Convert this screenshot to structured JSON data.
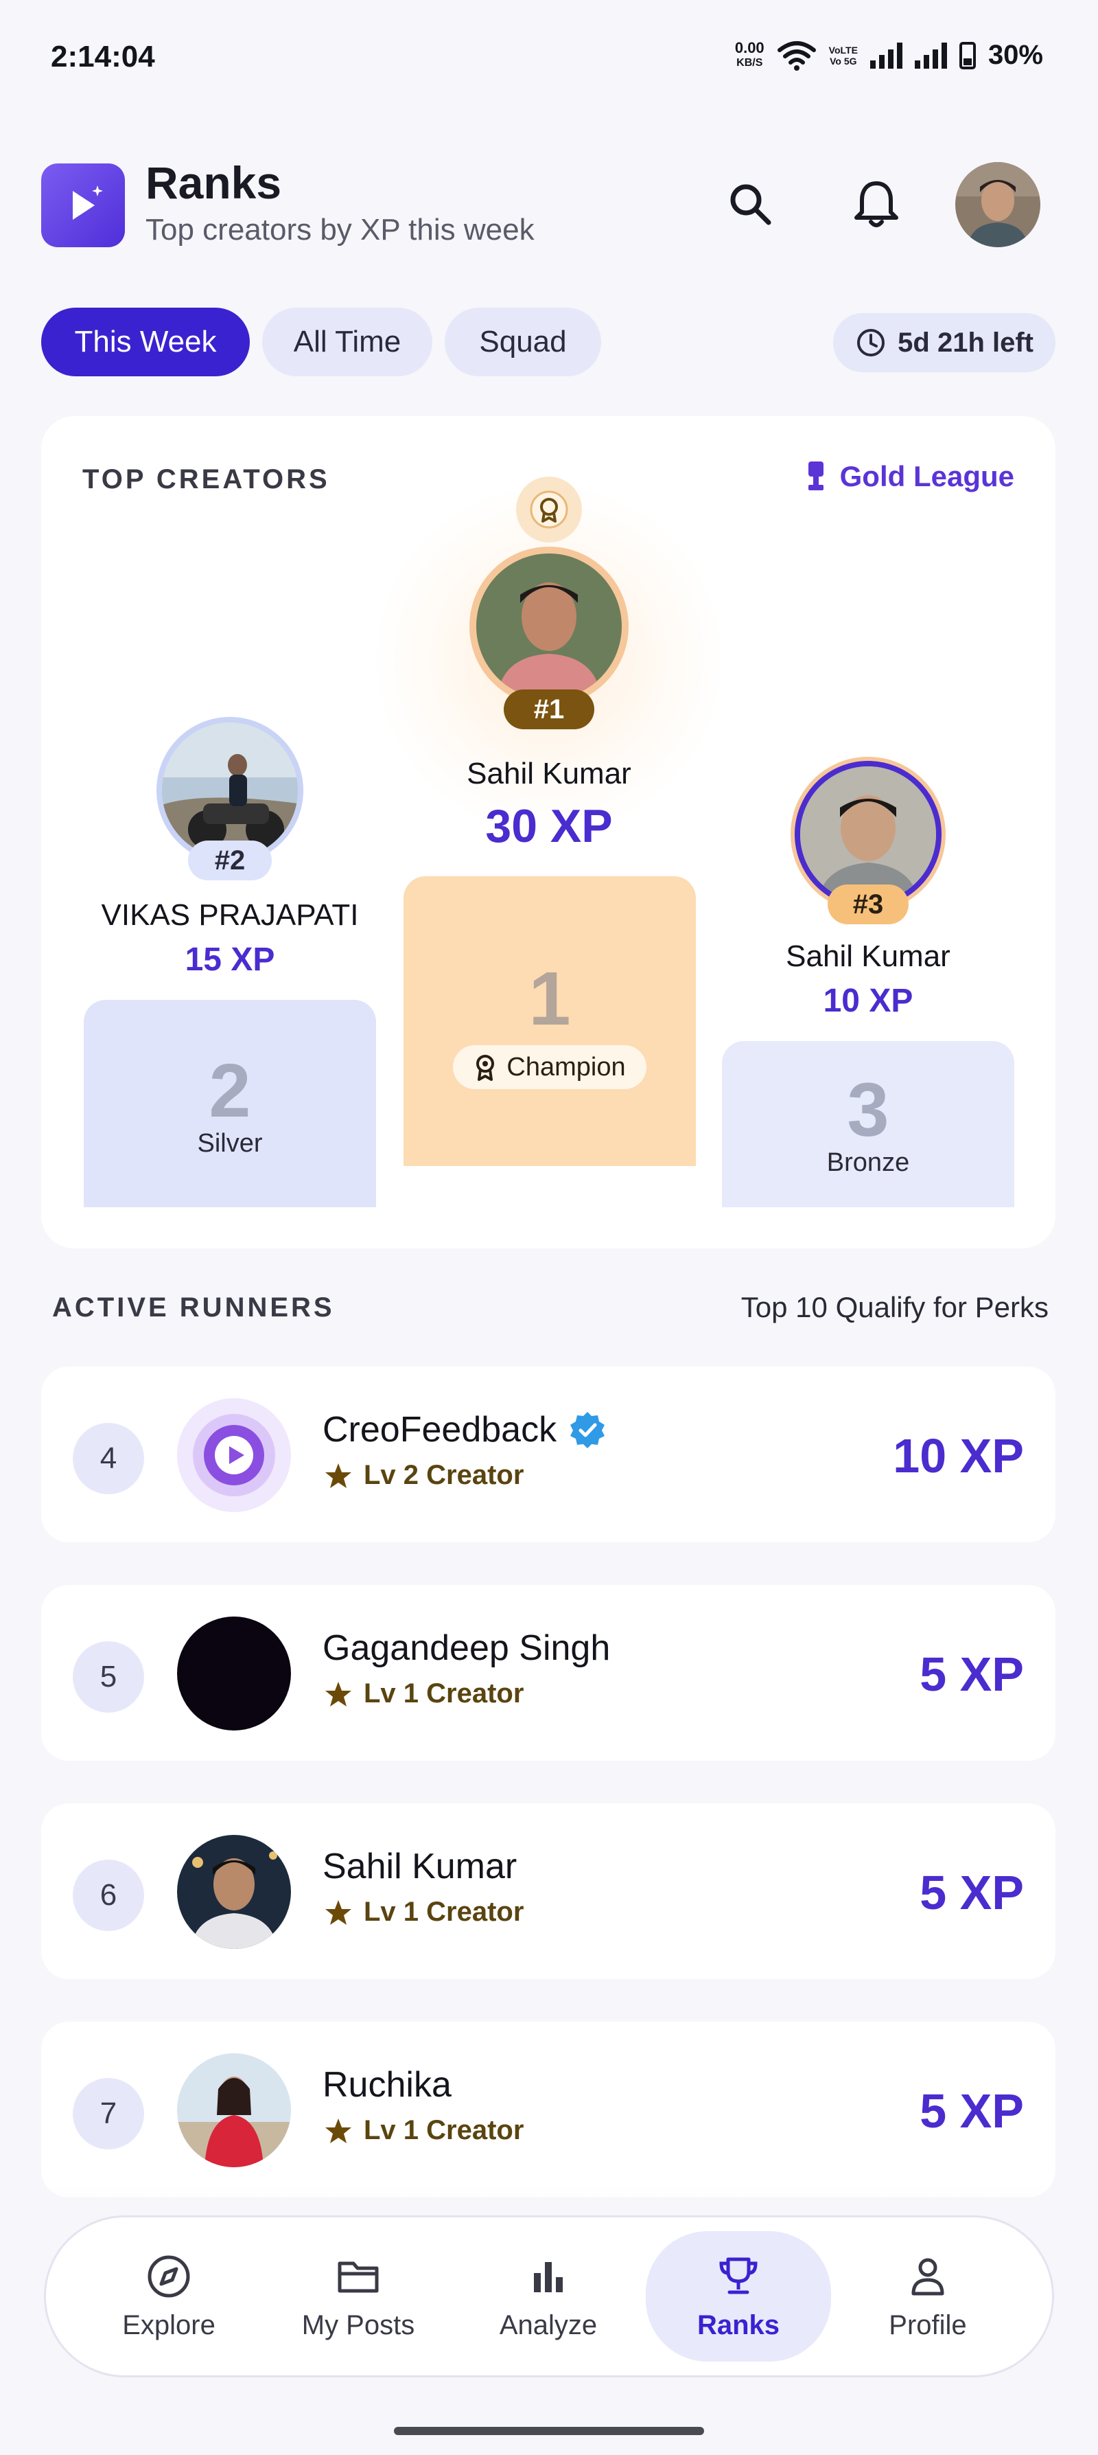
{
  "status_bar": {
    "time": "2:14:04",
    "net_speed_value": "0.00",
    "net_speed_unit": "KB/S",
    "volte_1": "VoLTE",
    "volte_2": "Vo 5G",
    "battery": "30%"
  },
  "header": {
    "title": "Ranks",
    "subtitle": "Top creators by XP this week"
  },
  "tabs": [
    {
      "label": "This Week",
      "active": true
    },
    {
      "label": "All Time",
      "active": false
    },
    {
      "label": "Squad",
      "active": false
    }
  ],
  "time_left": "5d 21h left",
  "top_creators": {
    "section_label": "TOP CREATORS",
    "league": "Gold League",
    "first": {
      "chip": "#1",
      "name": "Sahil Kumar",
      "xp": "30 XP",
      "block_num": "1",
      "block_label": "Champion"
    },
    "second": {
      "chip": "#2",
      "name": "VIKAS PRAJAPATI",
      "xp": "15 XP",
      "block_num": "2",
      "block_label": "Silver"
    },
    "third": {
      "chip": "#3",
      "name": "Sahil Kumar",
      "xp": "10 XP",
      "block_num": "3",
      "block_label": "Bronze"
    }
  },
  "runners": {
    "section_label": "ACTIVE RUNNERS",
    "note": "Top 10 Qualify for Perks",
    "rows": [
      {
        "rank": "4",
        "name": "CreoFeedback",
        "verified": true,
        "level": "Lv 2 Creator",
        "xp": "10 XP"
      },
      {
        "rank": "5",
        "name": "Gagandeep Singh",
        "verified": false,
        "level": "Lv 1 Creator",
        "xp": "5 XP"
      },
      {
        "rank": "6",
        "name": "Sahil Kumar",
        "verified": false,
        "level": "Lv 1 Creator",
        "xp": "5 XP"
      },
      {
        "rank": "7",
        "name": "Ruchika",
        "verified": false,
        "level": "Lv 1 Creator",
        "xp": "5 XP"
      }
    ]
  },
  "nav": [
    {
      "label": "Explore",
      "icon": "compass-icon",
      "active": false
    },
    {
      "label": "My Posts",
      "icon": "folder-icon",
      "active": false
    },
    {
      "label": "Analyze",
      "icon": "bar-chart-icon",
      "active": false
    },
    {
      "label": "Ranks",
      "icon": "trophy-icon",
      "active": true
    },
    {
      "label": "Profile",
      "icon": "person-icon",
      "active": false
    }
  ],
  "colors": {
    "accent": "#3a22d0",
    "xp_purple": "#4a2ccf",
    "gold_block": "#fddbb3",
    "silver_block": "#dfe4fb",
    "bronze_block": "#e7eafb"
  }
}
